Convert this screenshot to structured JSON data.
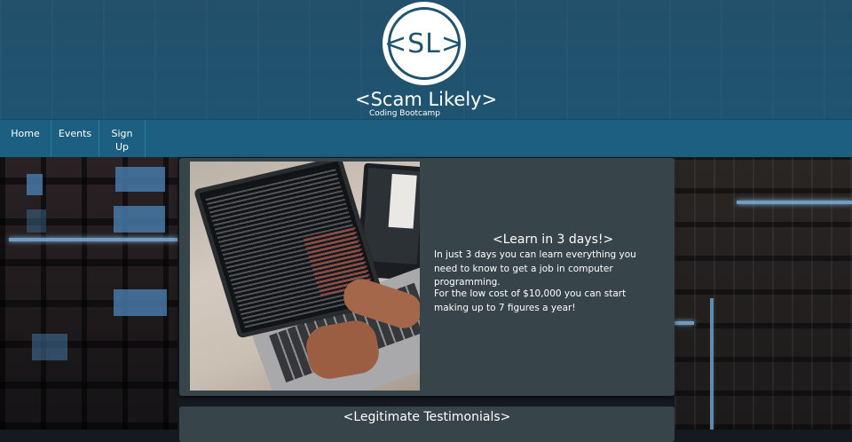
{
  "header": {
    "logo_text": "<SL>",
    "site_title": "<Scam Likely>",
    "site_subtitle": "Coding Bootcamp"
  },
  "nav": {
    "items": [
      {
        "label": "Home"
      },
      {
        "label": "Events"
      },
      {
        "label": "Sign Up"
      }
    ]
  },
  "hero": {
    "title": "<Learn in 3 days!>",
    "paragraph1": "In just 3 days you can learn everything you need to know to get a job in computer programming.",
    "paragraph2": "For the low cost of $10,000 you can start making up to 7 figures a year!"
  },
  "testimonials": {
    "title": "<Legitimate Testimonials>"
  },
  "colors": {
    "header_bg": "#1f5470",
    "nav_bg": "#1d5f80",
    "card_bg": "#3a484d"
  }
}
